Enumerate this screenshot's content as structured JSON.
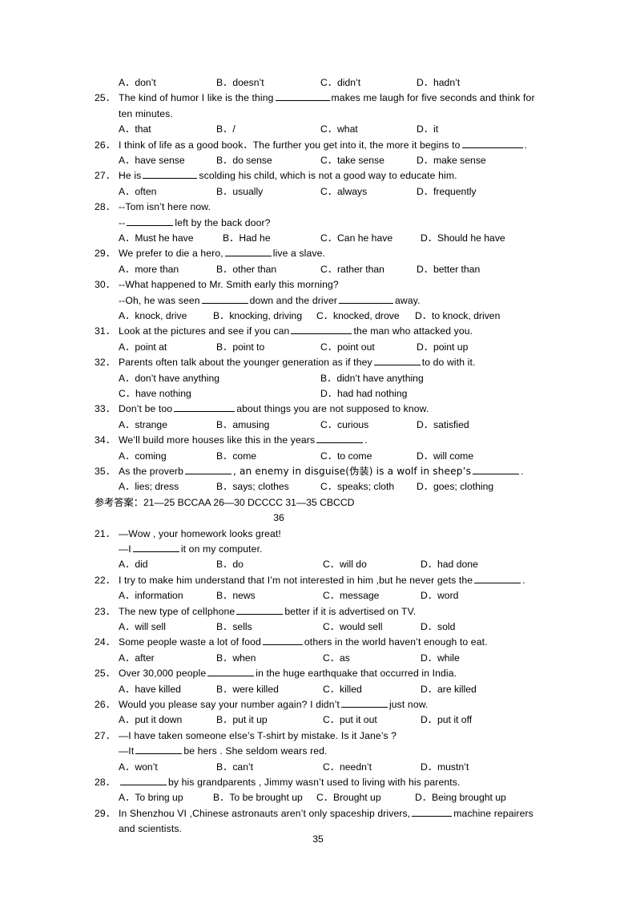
{
  "document": {
    "footer_page_number": "35",
    "interstitial_page_number": "36",
    "answer_key": {
      "label": "参考答案：",
      "ranges": "21—25 BCCAA    26—30 DCCCC    31—35 CBCCD"
    }
  },
  "section_one": {
    "orphan_options": {
      "a": "A．don’t",
      "b": "B．doesn’t",
      "c": "C．didn’t",
      "d": "D．hadn’t"
    },
    "questions": [
      {
        "number": "25．",
        "stem_part1": "The kind of humor I like is the thing",
        "stem_part2": "makes me laugh for five seconds and think for",
        "stem_line2": "ten minutes.",
        "options": [
          "A．that",
          "B．/",
          "C．what",
          "D．it"
        ]
      },
      {
        "number": "26．",
        "stem_part1": "I think of life as a good book．The further you get into it, the more it begins to",
        "stem_part2": ".",
        "options": [
          "A．have sense",
          "B．do sense",
          "C．take sense",
          "D．make sense"
        ]
      },
      {
        "number": "27．",
        "stem_part1": "He is",
        "stem_part2": "scolding his child, which is not a good way to educate him.",
        "options": [
          "A．often",
          "B．usually",
          "C．always",
          "D．frequently"
        ]
      },
      {
        "number": "28．",
        "stem_line1": "--Tom isn’t here now.",
        "dash": "--",
        "stem_part2": "left by the back door?",
        "options": [
          "A．Must he have",
          "B．Had he",
          "C．Can he have",
          "D．Should he have"
        ]
      },
      {
        "number": "29．",
        "stem_part1": "We prefer to die a hero,",
        "stem_part2": "live a slave.",
        "options": [
          "A．more than",
          "B．other than",
          "C．rather than",
          "D．better than"
        ]
      },
      {
        "number": "30．",
        "stem_line1": "--What happened to Mr. Smith early this morning?",
        "stem_part1": "--Oh, he was seen",
        "stem_part2": "down and the driver",
        "stem_part3": "away.",
        "options": [
          "A．knock, drive",
          "B．knocking, driving",
          "C．knocked, drove",
          "D．to knock, driven"
        ]
      },
      {
        "number": "31．",
        "stem_part1": "Look at the pictures and see if you can",
        "stem_part2": "the man who attacked you.",
        "options": [
          "A．point at",
          "B．point to",
          "C．point out",
          "D．point up"
        ]
      },
      {
        "number": "32．",
        "stem_part1": "Parents often talk about the younger generation as if they",
        "stem_part2": "to do with it.",
        "options": [
          "A．don’t have anything",
          "B．didn’t have anything",
          "C．have nothing",
          "D．had had nothing"
        ]
      },
      {
        "number": "33．",
        "stem_part1": "Don’t be too",
        "stem_part2": "about things you are not supposed to know.",
        "options": [
          "A．strange",
          "B．amusing",
          "C．curious",
          "D．satisfied"
        ]
      },
      {
        "number": "34．",
        "stem_part1": "We’ll build more houses like this in the years",
        "stem_part2": ".",
        "options": [
          "A．coming",
          "B．come",
          "C．to come",
          "D．will come"
        ]
      },
      {
        "number": "35．",
        "stem_part1": "As the proverb",
        "stem_part2": ", an enemy in disguise(伪装) is a wolf in sheep’s",
        "stem_part3": ".",
        "options": [
          "A．lies; dress",
          "B．says; clothes",
          "C．speaks; cloth",
          "D．goes; clothing"
        ]
      }
    ]
  },
  "section_two": {
    "questions": [
      {
        "number": "21．",
        "stem_line1": "—Wow , your homework looks great!",
        "stem_part1": "—I",
        "stem_part2": "it on my computer.",
        "options": [
          "A．did",
          "B．do",
          "C．will do",
          "D．had done"
        ]
      },
      {
        "number": "22．",
        "stem_part1": "I try to make him understand that I’m not interested in him ,but he never gets the",
        "stem_part2": ".",
        "options": [
          "A．information",
          "B．news",
          "C．message",
          "D．word"
        ]
      },
      {
        "number": "23．",
        "stem_part1": "The new type of cellphone",
        "stem_part2": "better if it is advertised on TV.",
        "options": [
          "A．will sell",
          "B．sells",
          "C．would sell",
          "D．sold"
        ]
      },
      {
        "number": "24．",
        "stem_part1": "Some people waste a lot of food",
        "stem_part2": "others in the world haven’t enough to eat.",
        "options": [
          "A．after",
          "B．when",
          "C．as",
          "D．while"
        ]
      },
      {
        "number": "25．",
        "stem_part1": "Over 30,000 people",
        "stem_part2": "in the huge earthquake that occurred in India.",
        "options": [
          "A．have killed",
          "B．were killed",
          "C．killed",
          "D．are killed"
        ]
      },
      {
        "number": "26．",
        "stem_part1": "Would you please say your number again? I didn’t",
        "stem_part2": "just now.",
        "options": [
          "A．put it down",
          "B．put it up",
          "C．put it out",
          "D．put it off"
        ]
      },
      {
        "number": "27．",
        "stem_line1": "—I have taken someone else’s T-shirt by mistake. Is it Jane’s ?",
        "stem_part1": "—It",
        "stem_part2": "be hers . She seldom wears red.",
        "options": [
          "A．won’t",
          "B．can’t",
          "C．needn’t",
          "D．mustn’t"
        ]
      },
      {
        "number": "28．",
        "stem_part1": "",
        "stem_part2": "by his grandparents , Jimmy wasn’t used to living with his parents.",
        "options": [
          "A．To bring up",
          "B．To be brought up",
          "C．Brought up",
          "D．Being brought up"
        ]
      },
      {
        "number": "29．",
        "stem_part1": "In Shenzhou VI ,Chinese astronauts aren’t only spaceship drivers,",
        "stem_part2": "machine repairers",
        "stem_line2": "and scientists.",
        "options": []
      }
    ]
  }
}
